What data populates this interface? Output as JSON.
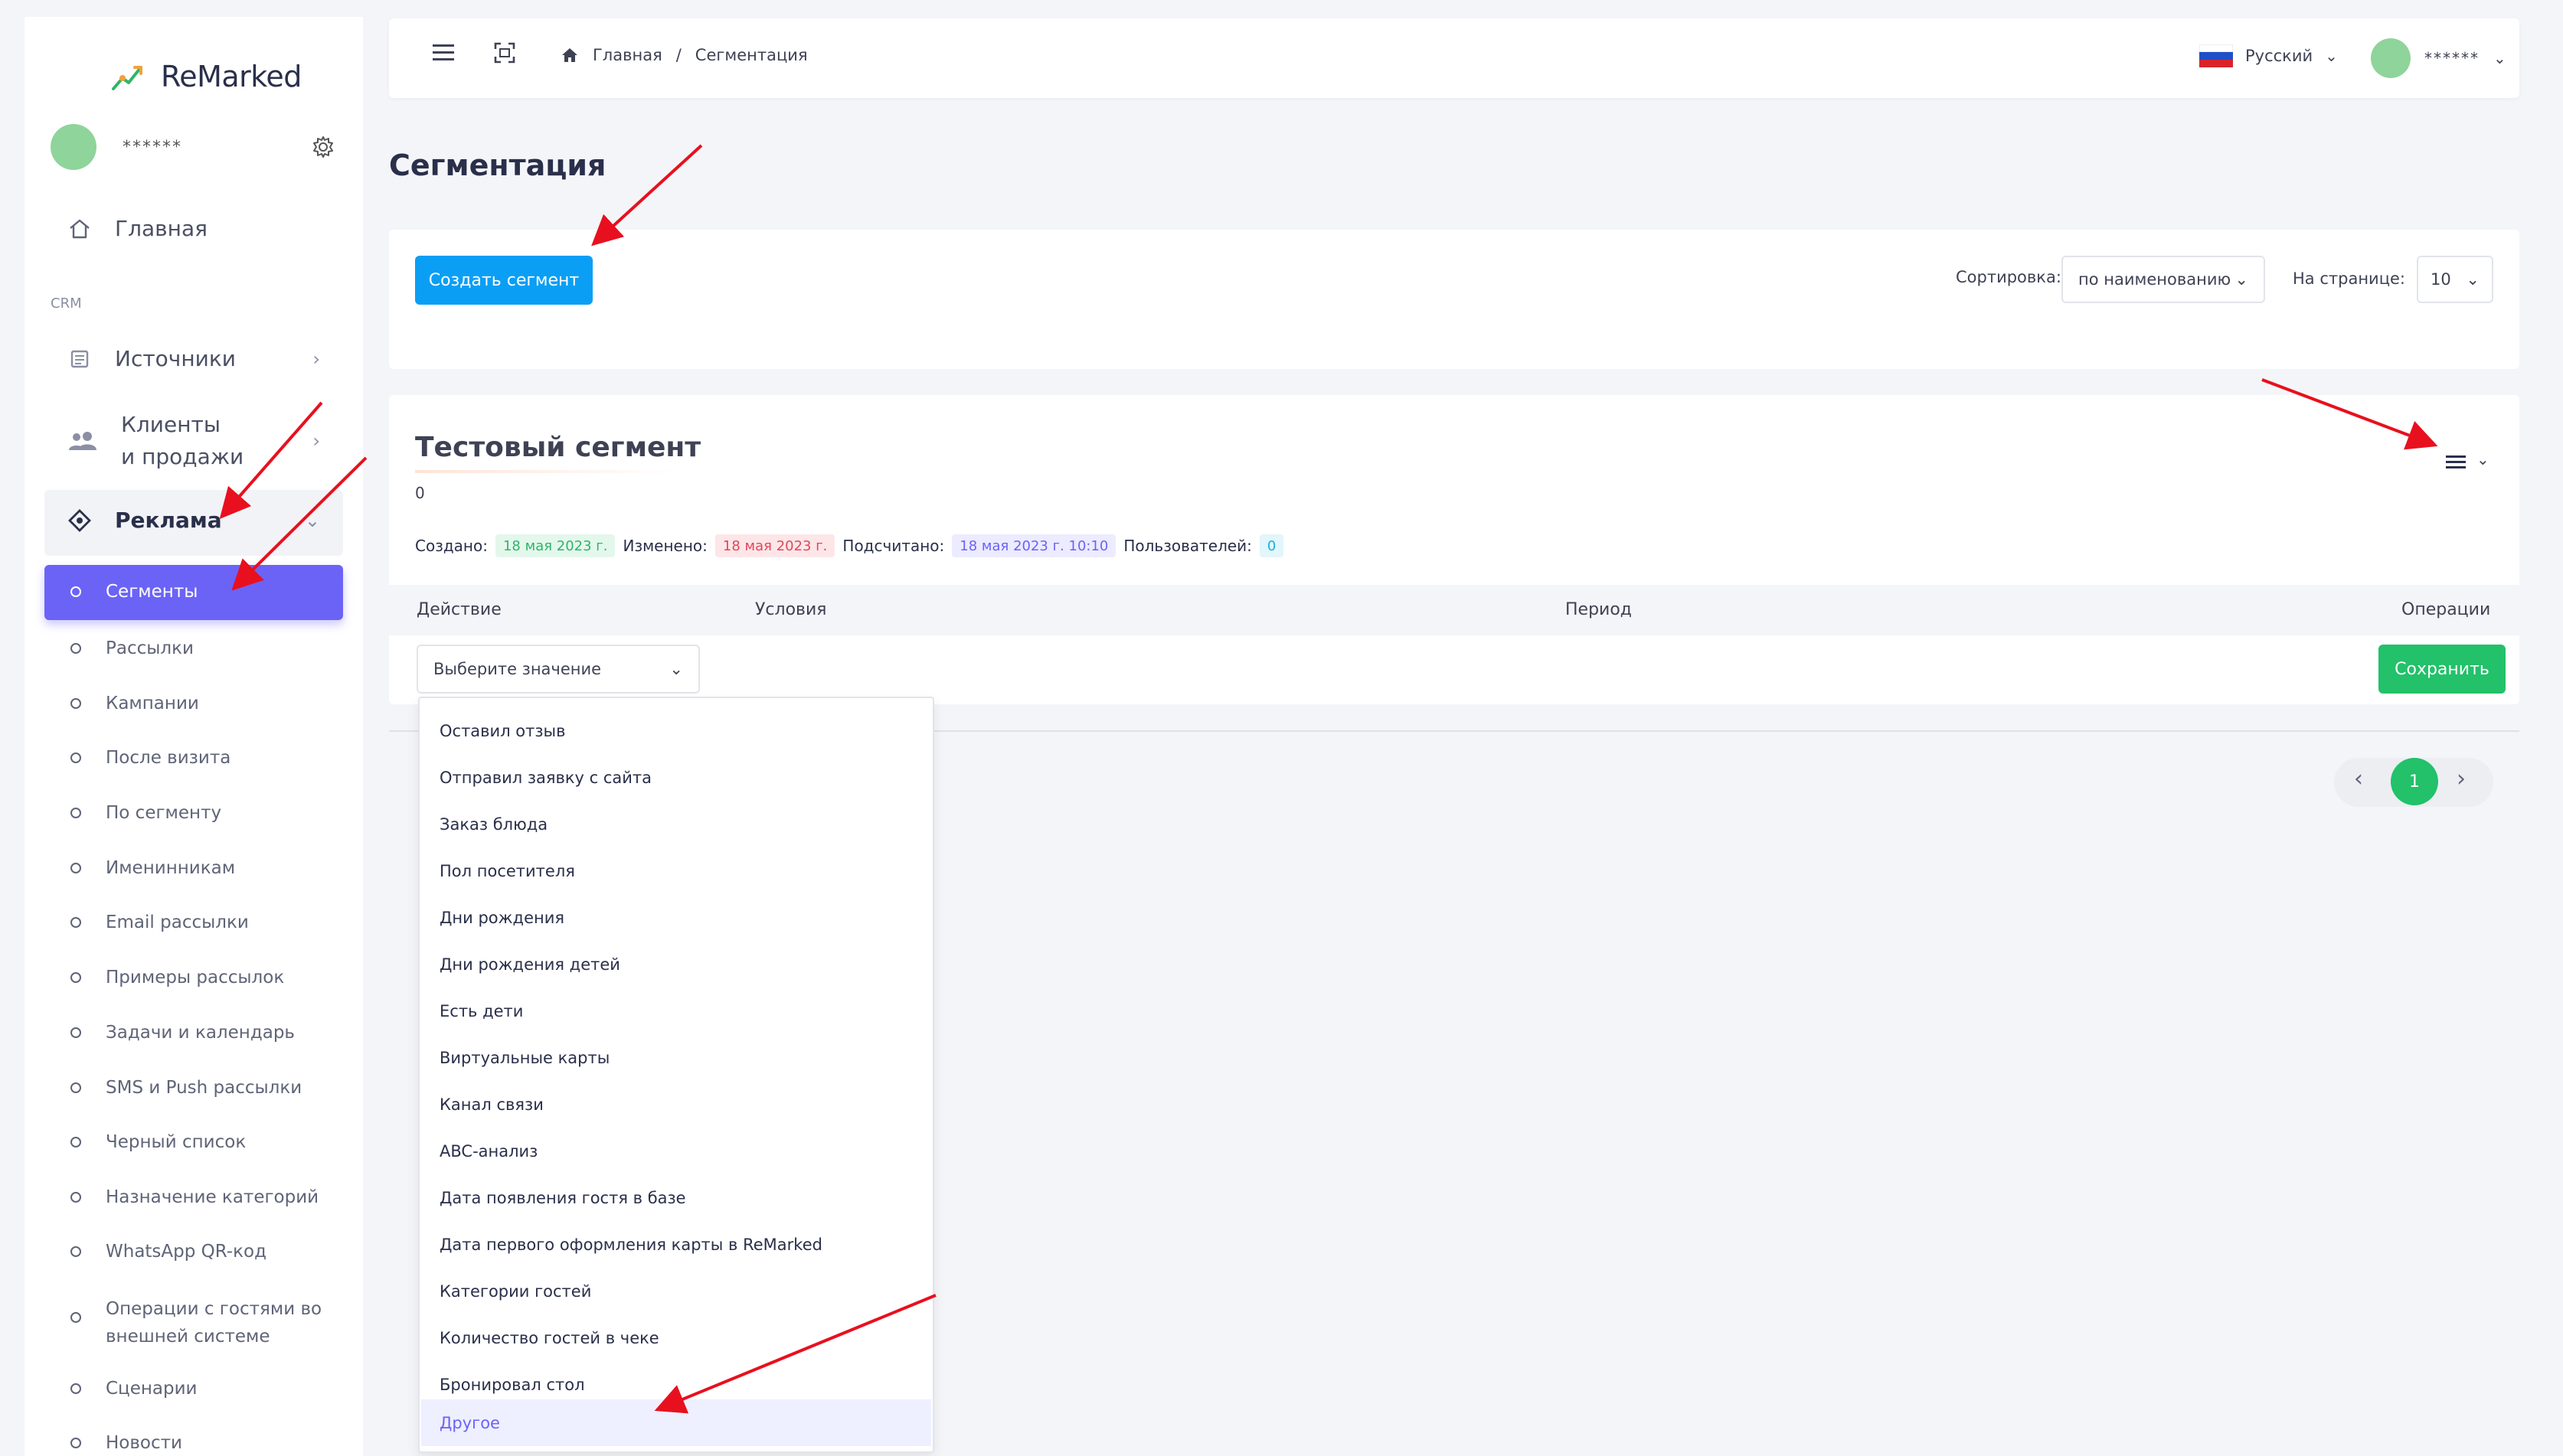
{
  "app": {
    "name": "ReMarked"
  },
  "user": {
    "name": "******"
  },
  "sidebar": {
    "home_label": "Главная",
    "section_label": "CRM",
    "items": [
      {
        "label": "Источники"
      },
      {
        "label_line1": "Клиенты",
        "label_line2": "и продажи"
      },
      {
        "label": "Реклама"
      }
    ],
    "subitems": [
      "Сегменты",
      "Рассылки",
      "Кампании",
      "После визита",
      "По сегменту",
      "Именинникам",
      "Email рассылки",
      "Примеры рассылок",
      "Задачи и календарь",
      "SMS и Push рассылки",
      "Черный список",
      "Назначение категорий",
      "WhatsApp QR-код",
      "Операции с гостями во",
      "внешней системе",
      "Сценарии",
      "Новости"
    ]
  },
  "header": {
    "breadcrumb": {
      "home": "Главная",
      "separator": "/",
      "current": "Сегментация"
    },
    "language": "Русский",
    "user_name": "******"
  },
  "page": {
    "title": "Сегментация"
  },
  "toolbar": {
    "create_button": "Создать сегмент",
    "sort_label": "Сортировка:",
    "sort_value": "по наименованию",
    "per_page_label": "На странице:",
    "per_page_value": "10"
  },
  "segment": {
    "title": "Тестовый сегмент",
    "count": "0",
    "created_label": "Создано:",
    "created_value": "18 мая 2023 г.",
    "modified_label": "Изменено:",
    "modified_value": "18 мая 2023 г.",
    "computed_label": "Подсчитано:",
    "computed_value": "18 мая 2023 г. 10:10",
    "users_label": "Пользователей:",
    "users_value": "0",
    "table": {
      "columns": [
        "Действие",
        "Условия",
        "Период",
        "Операции"
      ],
      "action_placeholder": "Выберите значение",
      "save_button": "Сохранить"
    }
  },
  "dropdown": {
    "options": [
      "Оставил отзыв",
      "Отправил заявку с сайта",
      "Заказ блюда",
      "Пол посетителя",
      "Дни рождения",
      "Дни рождения детей",
      "Есть дети",
      "Виртуальные карты",
      "Канал связи",
      "ABC-анализ",
      "Дата появления гостя в базе",
      "Дата первого оформления карты в ReMarked",
      "Категории гостей",
      "Количество гостей в чеке",
      "Бронировал стол",
      "Другое"
    ],
    "highlighted": "Другое"
  },
  "pagination": {
    "prev": "‹",
    "current": "1",
    "next": "›"
  },
  "colors": {
    "accent": "#6b63f6",
    "primary_button": "#0a9ff5",
    "save_button": "#22c16a",
    "annotation_arrow": "#e8101e"
  },
  "icons": [
    "trend-logo-icon",
    "gear-icon",
    "home-icon",
    "sources-icon",
    "clients-icon",
    "ads-icon",
    "burger-icon",
    "fullscreen-icon",
    "russian-flag-icon",
    "chevron-down-icon",
    "hamburger-menu-icon"
  ]
}
